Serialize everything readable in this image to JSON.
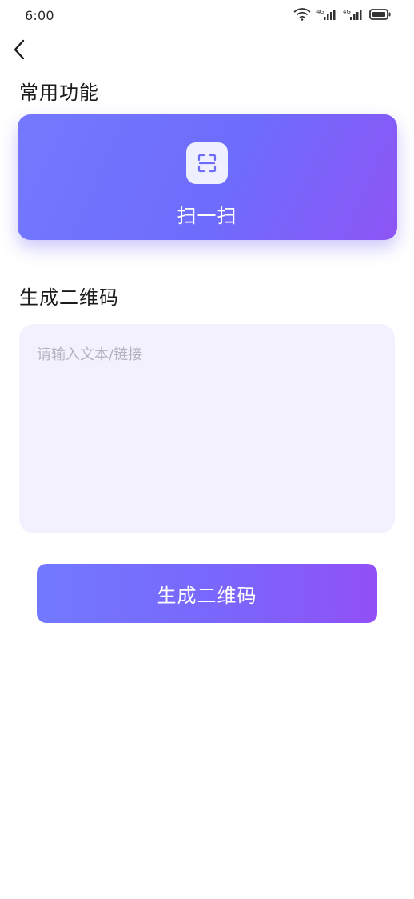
{
  "status_bar": {
    "time": "6:00",
    "icons": [
      "wifi-icon",
      "signal-icon",
      "signal-icon",
      "battery-icon"
    ]
  },
  "nav": {
    "back_icon": "chevron-left-icon"
  },
  "common": {
    "title": "常用功能",
    "scan": {
      "icon": "scan-icon",
      "label": "扫一扫"
    }
  },
  "generate": {
    "title": "生成二维码",
    "input": {
      "value": "",
      "placeholder": "请输入文本/链接"
    },
    "button_label": "生成二维码"
  },
  "colors": {
    "accent_start": "#7279ff",
    "accent_end": "#9250f6",
    "input_background": "#f3f1fd"
  }
}
